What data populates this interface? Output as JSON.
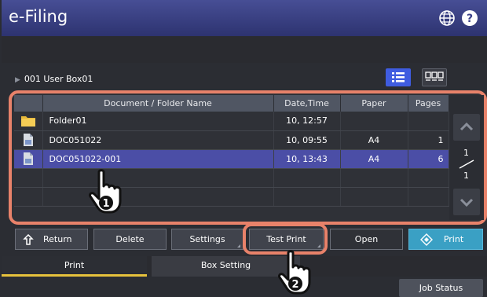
{
  "app": {
    "title": "e-Filing"
  },
  "header": {
    "globe_icon": "globe-icon",
    "help_icon": "question-icon"
  },
  "path": {
    "text": "001 User Box01"
  },
  "view_modes": [
    {
      "icon": "list-view-icon",
      "active": true
    },
    {
      "icon": "thumbnail-view-icon",
      "active": false
    }
  ],
  "table": {
    "columns": [
      "",
      "Document / Folder Name",
      "Date,Time",
      "Paper",
      "Pages"
    ],
    "rows": [
      {
        "icon": "folder-icon",
        "name": "Folder01",
        "date": "10, 12:57",
        "paper": "",
        "pages": ""
      },
      {
        "icon": "document-icon",
        "name": "DOC051022",
        "date": "10, 09:55",
        "paper": "A4",
        "pages": "1"
      },
      {
        "icon": "document-icon",
        "name": "DOC051022-001",
        "date": "10, 13:43",
        "paper": "A4",
        "pages": "6",
        "selected": true
      },
      {
        "icon": "",
        "name": "",
        "date": "",
        "paper": "",
        "pages": ""
      },
      {
        "icon": "",
        "name": "",
        "date": "",
        "paper": "",
        "pages": ""
      }
    ]
  },
  "pager": {
    "current": "1",
    "total": "1"
  },
  "actions": {
    "return": "Return",
    "delete": "Delete",
    "settings": "Settings",
    "test_print": "Test Print",
    "open": "Open",
    "print": "Print"
  },
  "tabs": {
    "print": "Print",
    "box_setting": "Box Setting"
  },
  "job_status": "Job Status",
  "callouts": {
    "one": "1",
    "two": "2"
  },
  "colors": {
    "header": "#3b418a",
    "selected_row": "#4b4ea6",
    "highlight": "#e8826a",
    "print_button": "#3aa0c4",
    "active_tab_underline": "#e6c23c"
  }
}
